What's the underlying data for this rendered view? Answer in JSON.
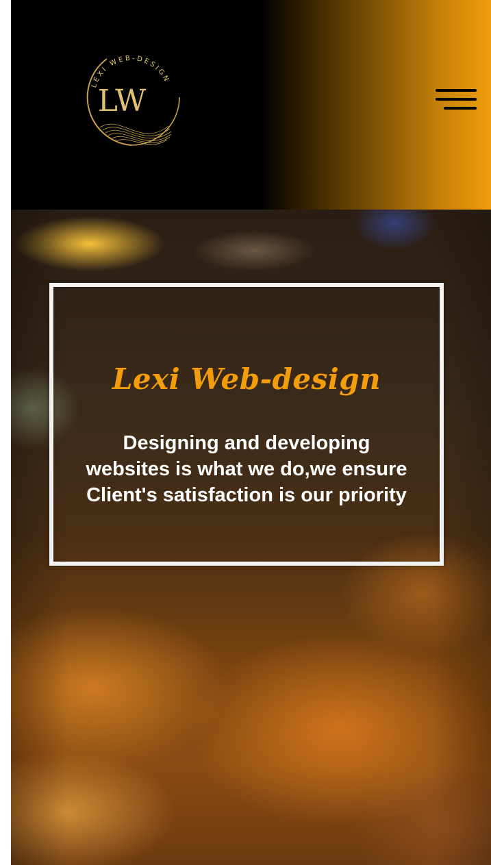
{
  "header": {
    "logo": {
      "monogram": "LW",
      "arc_text": "LEXI WEB-DESIGN",
      "icon": "logo-circle-icon"
    },
    "menu_icon": "hamburger-menu-icon"
  },
  "hero": {
    "title": "Lexi Web-design",
    "text": "Designing and developing websites is what we do,we ensure Client's satisfaction is our priority"
  },
  "colors": {
    "accent": "#f39c0c",
    "header_bg": "#000000",
    "hero_text": "#ffffff",
    "frame": "#f3f3f3"
  }
}
